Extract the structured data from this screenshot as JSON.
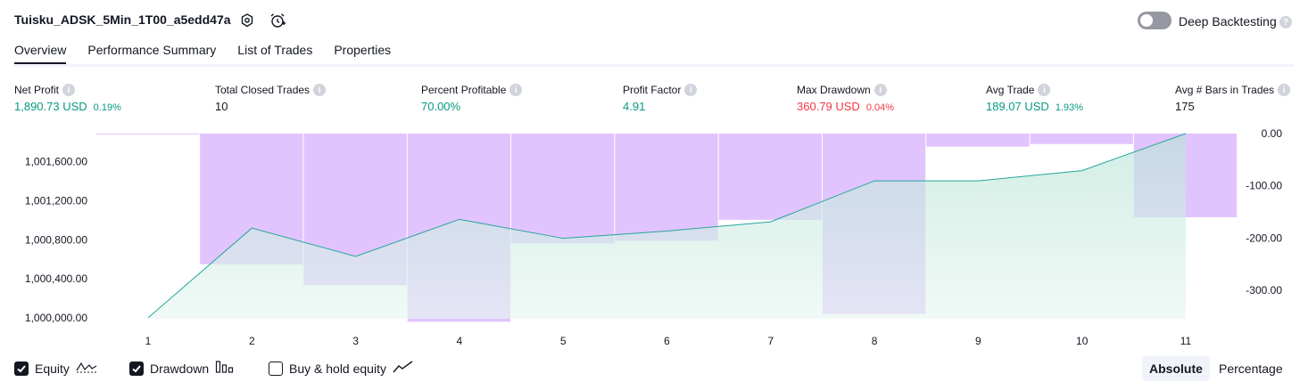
{
  "header": {
    "title": "Tuisku_ADSK_5Min_1T00_a5edd47a",
    "deep_backtesting_label": "Deep Backtesting",
    "deep_backtesting_enabled": false
  },
  "tabs": [
    {
      "label": "Overview",
      "active": true
    },
    {
      "label": "Performance Summary",
      "active": false
    },
    {
      "label": "List of Trades",
      "active": false
    },
    {
      "label": "Properties",
      "active": false
    }
  ],
  "metrics": {
    "net_profit": {
      "label": "Net Profit",
      "value": "1,890.73 USD",
      "pct": "0.19%"
    },
    "total_closed_trades": {
      "label": "Total Closed Trades",
      "value": "10"
    },
    "percent_profitable": {
      "label": "Percent Profitable",
      "value": "70.00%"
    },
    "profit_factor": {
      "label": "Profit Factor",
      "value": "4.91"
    },
    "max_drawdown": {
      "label": "Max Drawdown",
      "value": "360.79 USD",
      "pct": "0.04%"
    },
    "avg_trade": {
      "label": "Avg Trade",
      "value": "189.07 USD",
      "pct": "1.93%"
    },
    "avg_bars": {
      "label": "Avg # Bars in Trades",
      "value": "175"
    }
  },
  "colors": {
    "positive": "#089981",
    "negative": "#f23645",
    "equity_line": "#26a69a",
    "equity_fill": "#d4f0e8",
    "drawdown_bar": "#e1c4fd",
    "text": "#131722"
  },
  "chart_data": {
    "type": "area",
    "x": [
      1,
      2,
      3,
      4,
      5,
      6,
      7,
      8,
      9,
      10,
      11
    ],
    "series": [
      {
        "name": "Equity",
        "values": [
          1000000,
          1000920,
          1000630,
          1001010,
          1000815,
          1000890,
          1000985,
          1001405,
          1001405,
          1001510,
          1001890
        ]
      },
      {
        "name": "Drawdown",
        "values": [
          -1,
          -250,
          -290,
          -360,
          -210,
          -205,
          -165,
          -345,
          -25,
          -20,
          -160
        ]
      }
    ],
    "y_left_ticks": [
      "1,000,000.00",
      "1,000,400.00",
      "1,000,800.00",
      "1,001,200.00",
      "1,001,600.00"
    ],
    "y_right_ticks": [
      "0.00",
      "-100.00",
      "-200.00",
      "-300.00"
    ],
    "y_left_range": [
      999990,
      1001890
    ],
    "y_right_range": [
      -361,
      0
    ],
    "grid": false
  },
  "legend": [
    {
      "label": "Equity",
      "checked": true,
      "icon": "equity-line-icon"
    },
    {
      "label": "Drawdown",
      "checked": true,
      "icon": "drawdown-bars-icon"
    },
    {
      "label": "Buy & hold equity",
      "checked": false,
      "icon": "buy-hold-line-icon"
    }
  ],
  "view_mode": {
    "absolute": "Absolute",
    "percentage": "Percentage",
    "selected": "absolute"
  }
}
